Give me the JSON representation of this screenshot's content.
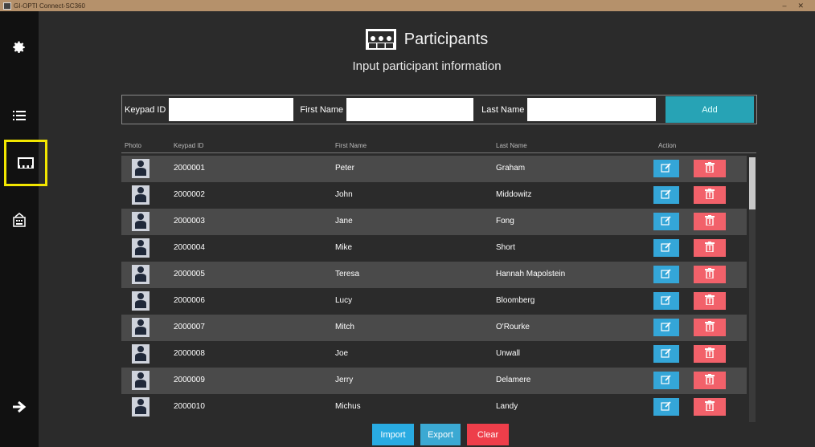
{
  "window": {
    "title": "GI-OPTI Connect-SC360"
  },
  "sidebar": {
    "items": [
      {
        "icon": "gear-icon"
      },
      {
        "icon": "list-icon"
      },
      {
        "icon": "participants-icon"
      },
      {
        "icon": "keypad-icon"
      },
      {
        "icon": "arrow-right-icon"
      }
    ]
  },
  "header": {
    "title": "Participants",
    "subtitle": "Input participant information"
  },
  "form": {
    "keypad_label": "Keypad ID",
    "first_label": "First Name",
    "last_label": "Last Name",
    "keypad_value": "",
    "first_value": "",
    "last_value": "",
    "add_label": "Add"
  },
  "table": {
    "columns": [
      "Photo",
      "Keypad ID",
      "First Name",
      "Last Name",
      "Action"
    ],
    "rows": [
      {
        "id": "2000001",
        "first": "Peter",
        "last": "Graham"
      },
      {
        "id": "2000002",
        "first": "John",
        "last": "Middowitz"
      },
      {
        "id": "2000003",
        "first": "Jane",
        "last": "Fong"
      },
      {
        "id": "2000004",
        "first": "Mike",
        "last": "Short"
      },
      {
        "id": "2000005",
        "first": "Teresa",
        "last": "Hannah Mapolstein"
      },
      {
        "id": "2000006",
        "first": "Lucy",
        "last": "Bloomberg"
      },
      {
        "id": "2000007",
        "first": "Mitch",
        "last": "O'Rourke"
      },
      {
        "id": "2000008",
        "first": "Joe",
        "last": "Unwall"
      },
      {
        "id": "2000009",
        "first": "Jerry",
        "last": "Delamere"
      },
      {
        "id": "2000010",
        "first": "Michus",
        "last": "Landy"
      }
    ]
  },
  "footer": {
    "import_label": "Import",
    "export_label": "Export",
    "clear_label": "Clear"
  },
  "colors": {
    "accent": "#27a3b5",
    "edit": "#34a6d8",
    "delete": "#f2616a",
    "highlight": "#f2e600"
  }
}
